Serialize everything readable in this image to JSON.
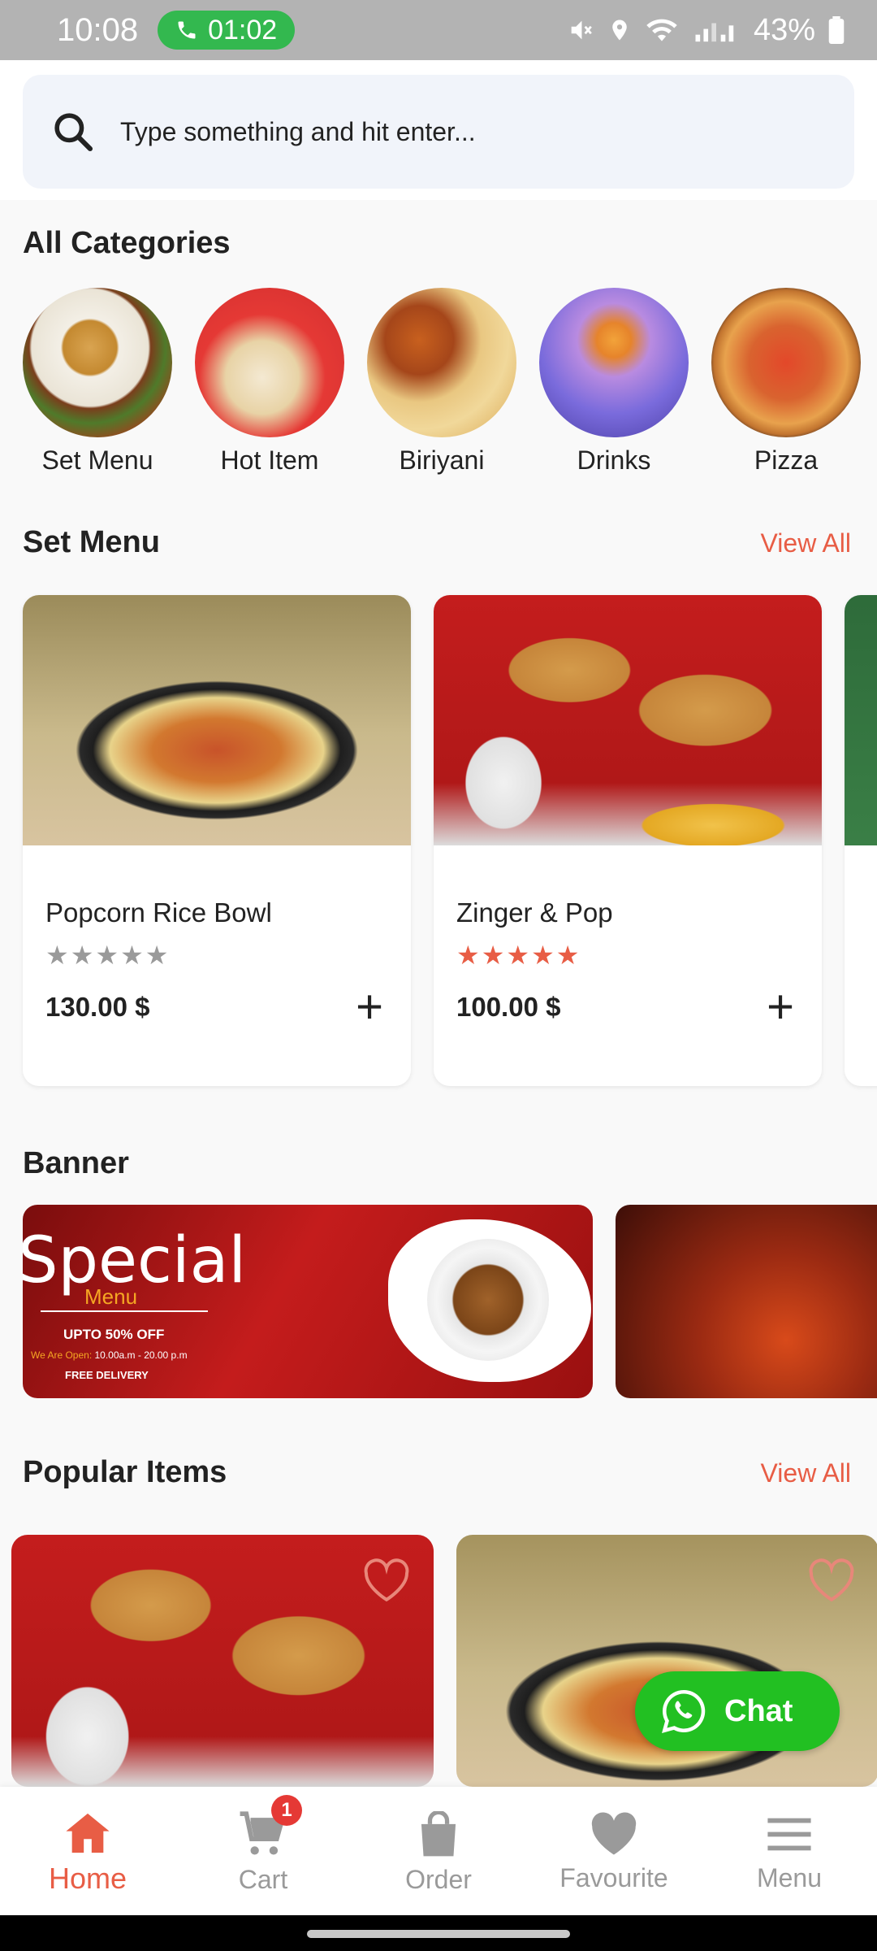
{
  "status_bar": {
    "time": "10:08",
    "call_timer": "01:02",
    "battery": "43%"
  },
  "search": {
    "placeholder": "Type something and hit enter..."
  },
  "categories": {
    "title": "All Categories",
    "items": [
      {
        "label": "Set Menu"
      },
      {
        "label": "Hot Item"
      },
      {
        "label": "Biriyani"
      },
      {
        "label": "Drinks"
      },
      {
        "label": "Pizza"
      }
    ]
  },
  "set_menu": {
    "title": "Set Menu",
    "view_all": "View All",
    "items": [
      {
        "name": "Popcorn Rice Bowl",
        "rating": 0,
        "max_rating": 5,
        "price": "130.00 $"
      },
      {
        "name": "Zinger & Pop",
        "rating": 5,
        "max_rating": 5,
        "price": "100.00 $"
      }
    ]
  },
  "banner": {
    "title": "Banner",
    "special": "Special",
    "menu": "Menu",
    "offer": "UPTO 50% OFF",
    "open_prefix": "We Are Open:",
    "open_hours": "10.00a.m - 20.00 p.m",
    "delivery": "FREE DELIVERY"
  },
  "popular": {
    "title": "Popular Items",
    "view_all": "View All"
  },
  "chat": {
    "label": "Chat"
  },
  "bottom_nav": {
    "items": [
      {
        "label": "Home",
        "icon": "home-icon",
        "active": true
      },
      {
        "label": "Cart",
        "icon": "cart-icon",
        "badge": "1"
      },
      {
        "label": "Order",
        "icon": "bag-icon"
      },
      {
        "label": "Favourite",
        "icon": "heart-icon"
      },
      {
        "label": "Menu",
        "icon": "hamburger-icon"
      }
    ]
  },
  "colors": {
    "accent": "#e85d45",
    "status_bar": "#b3b3b3",
    "call_pill": "#33b84f",
    "chat": "#22c022",
    "star_active": "#e85d45",
    "star_inactive": "#9a9a9a"
  }
}
